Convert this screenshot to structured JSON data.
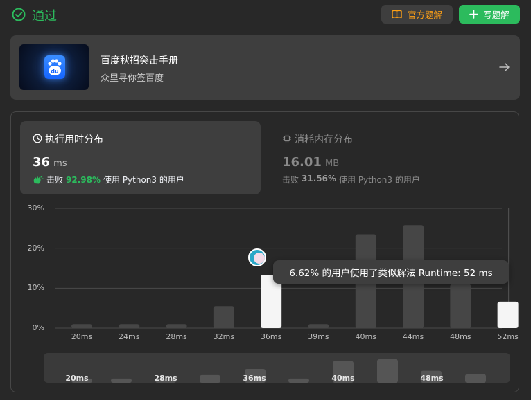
{
  "header": {
    "status": "通过",
    "official_solution": "官方题解",
    "write_solution": "写题解",
    "colors": {
      "accepted": "#2cbb5d",
      "official": "#ffa116"
    }
  },
  "promo": {
    "title": "百度秋招突击手册",
    "subtitle": "众里寻你签百度",
    "logo_text": "du"
  },
  "runtime": {
    "label": "执行用时分布",
    "value": "36",
    "unit": "ms",
    "beats_prefix": "击败",
    "beats_percent": "92.98%",
    "beats_suffix": "使用 Python3 的用户"
  },
  "memory": {
    "label": "消耗内存分布",
    "value": "16.01",
    "unit": "MB",
    "beats_prefix": "击败",
    "beats_percent": "31.56%",
    "beats_suffix": "使用 Python3 的用户"
  },
  "tooltip": "6.62% 的用户使用了类似解法 Runtime: 52 ms",
  "chart_data": {
    "type": "bar",
    "categories": [
      "20ms",
      "24ms",
      "28ms",
      "32ms",
      "36ms",
      "39ms",
      "40ms",
      "44ms",
      "48ms",
      "52ms"
    ],
    "values": [
      1,
      1,
      1,
      5.5,
      13.3,
      1,
      23.5,
      25.8,
      11,
      6.62
    ],
    "highlighted": [
      "36ms",
      "52ms"
    ],
    "yticks": [
      "30%",
      "20%",
      "10%",
      "0%"
    ],
    "ylim": [
      0,
      30
    ],
    "grid": true
  },
  "mini_chart": {
    "labels": [
      "20ms",
      "28ms",
      "36ms",
      "40ms",
      "48ms"
    ]
  }
}
